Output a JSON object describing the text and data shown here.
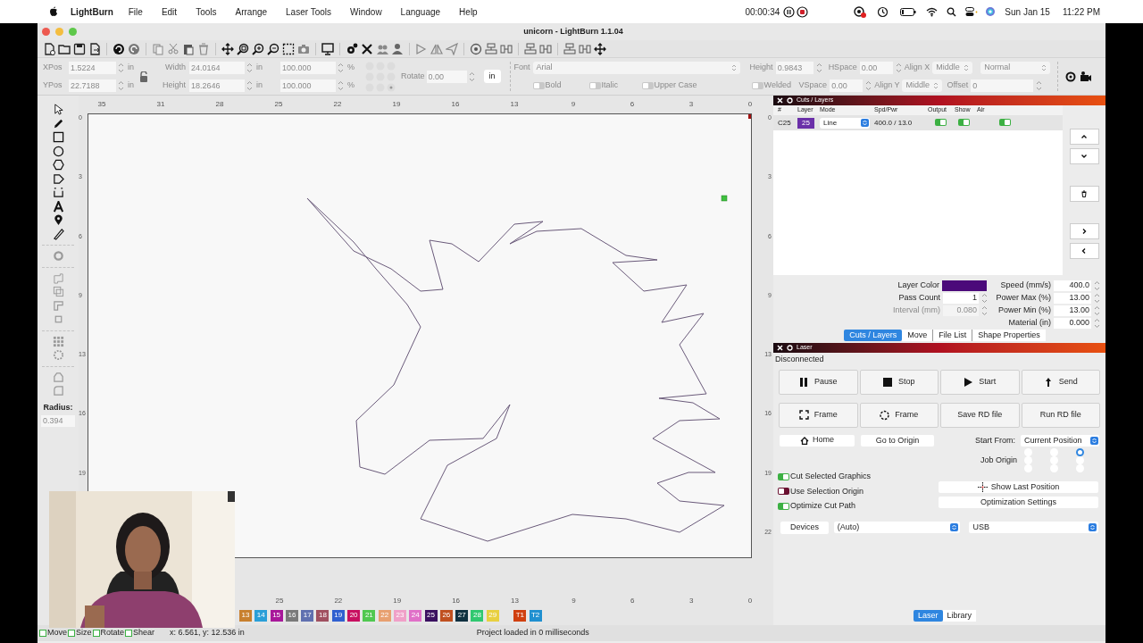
{
  "menu_bar": {
    "app": "LightBurn",
    "menus": [
      "File",
      "Edit",
      "Tools",
      "Arrange",
      "Laser Tools",
      "Window",
      "Language",
      "Help"
    ],
    "recording_time": "00:00:34",
    "date": "Sun Jan 15",
    "time": "11:22 PM"
  },
  "window": {
    "title": "unicorn - LightBurn 1.1.04"
  },
  "property_bar": {
    "fields": [
      {
        "label": "XPos",
        "value": "1.5224",
        "unit": "in"
      },
      {
        "label": "YPos",
        "value": "22.7188",
        "unit": "in"
      }
    ],
    "size_fields": [
      {
        "label": "Width",
        "value": "24.0164",
        "unit": "in",
        "scale": "100.000",
        "pct": "%"
      },
      {
        "label": "Height",
        "value": "18.2646",
        "unit": "in",
        "scale": "100.000",
        "pct": "%"
      }
    ],
    "rotate": {
      "label": "Rotate",
      "value": "0.00"
    },
    "unit_button": "in",
    "font": {
      "label": "Font",
      "value": "Arial"
    },
    "toggles": [
      {
        "label": "Bold",
        "on": false
      },
      {
        "label": "Italic",
        "on": false
      },
      {
        "label": "Upper Case",
        "on": false
      },
      {
        "label": "Welded",
        "on": false
      }
    ],
    "text_height": {
      "label": "Height",
      "value": "0.9843"
    },
    "hspace": {
      "label": "HSpace",
      "value": "0.00"
    },
    "vspace": {
      "label": "VSpace",
      "value": "0.00"
    },
    "align_x": {
      "label": "Align X",
      "value": "Middle"
    },
    "align_y": {
      "label": "Align Y",
      "value": "Middle"
    },
    "style": {
      "value": "Normal"
    },
    "offset": {
      "label": "Offset",
      "value": "0"
    },
    "disabled": true
  },
  "tools": {
    "radius_label": "Radius:",
    "radius_value": "0.394"
  },
  "canvas": {
    "top_ruler": [
      "35",
      "31",
      "28",
      "25",
      "22",
      "19",
      "16",
      "13",
      "9",
      "6",
      "3",
      "0"
    ],
    "left_ruler": [
      "0",
      "3",
      "6",
      "9",
      "13",
      "16",
      "19"
    ],
    "right_ruler": [
      "0",
      "3",
      "6",
      "9",
      "13",
      "16",
      "19",
      "22"
    ],
    "bottom_ruler": [
      "25",
      "22",
      "19",
      "16",
      "13",
      "9",
      "6",
      "3",
      "0"
    ]
  },
  "palette": [
    {
      "label": "13",
      "color": "#c8802e"
    },
    {
      "label": "14",
      "color": "#2a9fd8"
    },
    {
      "label": "15",
      "color": "#a8189a"
    },
    {
      "label": "16",
      "color": "#7a7a7a"
    },
    {
      "label": "17",
      "color": "#6070b0"
    },
    {
      "label": "18",
      "color": "#a05060"
    },
    {
      "label": "19",
      "color": "#3060d0"
    },
    {
      "label": "20",
      "color": "#c81060"
    },
    {
      "label": "21",
      "color": "#50c850"
    },
    {
      "label": "22",
      "color": "#e8a070"
    },
    {
      "label": "23",
      "color": "#f0a0c8"
    },
    {
      "label": "24",
      "color": "#e070c8"
    },
    {
      "label": "25",
      "color": "#3a1060"
    },
    {
      "label": "26",
      "color": "#c05020"
    },
    {
      "label": "27",
      "color": "#103040"
    },
    {
      "label": "28",
      "color": "#30c870"
    },
    {
      "label": "29",
      "color": "#e8d040"
    },
    {
      "label": "T1",
      "color": "#d04010"
    },
    {
      "label": "T2",
      "color": "#2090d0"
    }
  ],
  "cuts_panel": {
    "title": "Cuts / Layers",
    "columns": [
      "#",
      "Layer",
      "Mode",
      "Spd/Pwr",
      "Output",
      "Show",
      "Air"
    ],
    "rows": [
      {
        "id": "C25",
        "layer": "25",
        "color": "#6a2fa8",
        "mode": "Line",
        "spd_pwr": "400.0 / 13.0",
        "output": true,
        "show": true,
        "air": true
      }
    ],
    "layer_color": {
      "label": "Layer Color",
      "color": "#4b0a7a"
    },
    "left_fields": [
      {
        "label": "Pass Count",
        "value": "1",
        "disabled": false
      },
      {
        "label": "Interval (mm)",
        "value": "0.080",
        "disabled": true
      }
    ],
    "right_fields": [
      {
        "label": "Speed (mm/s)",
        "value": "400.0"
      },
      {
        "label": "Power Max (%)",
        "value": "13.00"
      },
      {
        "label": "Power Min (%)",
        "value": "13.00"
      },
      {
        "label": "Material (in)",
        "value": "0.000"
      }
    ],
    "tabs": [
      {
        "label": "Cuts / Layers",
        "selected": true
      },
      {
        "label": "Move",
        "selected": false
      },
      {
        "label": "File List",
        "selected": false
      },
      {
        "label": "Shape Properties",
        "selected": false
      }
    ]
  },
  "laser_panel": {
    "title": "Laser",
    "status": "Disconnected",
    "buttons": [
      {
        "label": "Pause",
        "kind": "pause"
      },
      {
        "label": "Stop",
        "kind": "stop"
      },
      {
        "label": "Start",
        "kind": "start"
      },
      {
        "label": "Send",
        "kind": "send"
      },
      {
        "label": "Frame",
        "kind": "frame-rect"
      },
      {
        "label": "Frame",
        "kind": "frame-circle"
      },
      {
        "label": "Save RD file",
        "kind": "plain"
      },
      {
        "label": "Run RD file",
        "kind": "plain"
      }
    ],
    "home": "Home",
    "go_to_origin": "Go to Origin",
    "start_from": {
      "label": "Start From:",
      "value": "Current Position"
    },
    "job_origin": {
      "label": "Job Origin",
      "options": [
        {
          "selected": false
        },
        {
          "selected": false
        },
        {
          "selected": true
        },
        {
          "selected": false
        },
        {
          "selected": false
        },
        {
          "selected": false
        },
        {
          "selected": false
        },
        {
          "selected": false
        },
        {
          "selected": false
        }
      ]
    },
    "toggles": [
      {
        "label": "Cut Selected Graphics",
        "on": true
      },
      {
        "label": "Use Selection Origin",
        "on": false
      },
      {
        "label": "Optimize Cut Path",
        "on": true
      }
    ],
    "show_last_position": "Show Last Position",
    "optimization_settings": "Optimization Settings",
    "devices": "Devices",
    "device": "(Auto)",
    "connection": "USB",
    "tabs": [
      {
        "label": "Laser",
        "selected": true
      },
      {
        "label": "Library",
        "selected": false
      }
    ]
  },
  "status_bar": {
    "toggles": [
      {
        "label": "Move",
        "on": false
      },
      {
        "label": "Size",
        "on": false
      },
      {
        "label": "Rotate",
        "on": false
      },
      {
        "label": "Shear",
        "on": false
      }
    ],
    "coords": "x: 6.561, y: 12.536 in",
    "message": "Project loaded in 0 milliseconds"
  }
}
